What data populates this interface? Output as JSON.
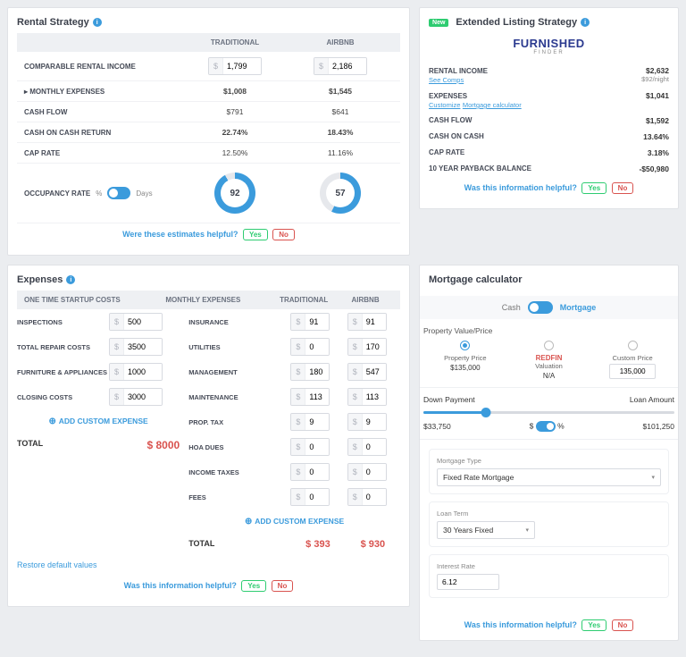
{
  "rental": {
    "title": "Rental Strategy",
    "col_trad": "TRADITIONAL",
    "col_air": "AIRBNB",
    "rows": {
      "income_lbl": "COMPARABLE RENTAL INCOME",
      "income_trad": "1,799",
      "income_air": "2,186",
      "monthly_lbl": "▸ MONTHLY EXPENSES",
      "monthly_trad": "$1,008",
      "monthly_air": "$1,545",
      "cash_lbl": "CASH FLOW",
      "cash_trad": "$791",
      "cash_air": "$641",
      "coc_lbl": "CASH ON CASH RETURN",
      "coc_trad": "22.74%",
      "coc_air": "18.43%",
      "cap_lbl": "CAP RATE",
      "cap_trad": "12.50%",
      "cap_air": "11.16%",
      "occ_lbl": "OCCUPANCY RATE",
      "occ_pct": "%",
      "occ_days": "Days",
      "occ_trad": "92",
      "occ_air": "57"
    },
    "helpful": "Were these estimates helpful?",
    "yes": "Yes",
    "no": "No"
  },
  "ext": {
    "badge": "New",
    "title": "Extended Listing Strategy",
    "logo_main": "FURNISHED",
    "logo_sub": "FINDER",
    "rows": {
      "income_lbl": "RENTAL INCOME",
      "income_val": "$2,632",
      "income_link": "See Comps",
      "income_sub": "$92/night",
      "exp_lbl": "EXPENSES",
      "exp_val": "$1,041",
      "exp_link1": "Customize",
      "exp_link2": "Mortgage calculator",
      "cf_lbl": "CASH FLOW",
      "cf_val": "$1,592",
      "coc_lbl": "CASH ON CASH",
      "coc_val": "13.64%",
      "cap_lbl": "CAP RATE",
      "cap_val": "3.18%",
      "pb_lbl": "10 YEAR PAYBACK BALANCE",
      "pb_val": "-$50,980"
    },
    "helpful": "Was this information helpful?",
    "yes": "Yes",
    "no": "No"
  },
  "expenses": {
    "title": "Expenses",
    "col_one": "ONE TIME STARTUP COSTS",
    "col_monthly": "MONTHLY EXPENSES",
    "col_trad": "TRADITIONAL",
    "col_air": "AIRBNB",
    "one": {
      "insp_lbl": "INSPECTIONS",
      "insp_v": "500",
      "repair_lbl": "TOTAL REPAIR COSTS",
      "repair_v": "3500",
      "furn_lbl": "FURNITURE & APPLIANCES",
      "furn_v": "1000",
      "close_lbl": "CLOSING COSTS",
      "close_v": "3000",
      "total_lbl": "TOTAL",
      "total_v": "$ 8000"
    },
    "monthly": {
      "ins_lbl": "INSURANCE",
      "ins_t": "91",
      "ins_a": "91",
      "util_lbl": "UTILITIES",
      "util_t": "0",
      "util_a": "170",
      "mgmt_lbl": "MANAGEMENT",
      "mgmt_t": "180",
      "mgmt_a": "547",
      "maint_lbl": "MAINTENANCE",
      "maint_t": "113",
      "maint_a": "113",
      "tax_lbl": "PROP. TAX",
      "tax_t": "9",
      "tax_a": "9",
      "hoa_lbl": "HOA DUES",
      "hoa_t": "0",
      "hoa_a": "0",
      "inc_lbl": "INCOME TAXES",
      "inc_t": "0",
      "inc_a": "0",
      "fee_lbl": "FEES",
      "fee_t": "0",
      "fee_a": "0",
      "total_lbl": "TOTAL",
      "total_t": "$ 393",
      "total_a": "$ 930"
    },
    "add": "ADD CUSTOM EXPENSE",
    "restore": "Restore default values",
    "helpful": "Was this information helpful?",
    "yes": "Yes",
    "no": "No"
  },
  "mort": {
    "title": "Mortgage calculator",
    "tab_cash": "Cash",
    "tab_mort": "Mortgage",
    "pv_title": "Property Value/Price",
    "pp_lbl": "Property Price",
    "pp_v": "$135,000",
    "rf_lbl": "Valuation",
    "rf_brand": "REDFIN",
    "rf_v": "N/A",
    "cp_lbl": "Custom Price",
    "cp_v": "135,000",
    "dp_lbl": "Down Payment",
    "la_lbl": "Loan Amount",
    "dp_v": "$33,750",
    "dp_unit": "$",
    "dp_pct": "%",
    "la_v": "$101,250",
    "mt_lbl": "Mortgage Type",
    "mt_v": "Fixed Rate Mortgage",
    "lt_lbl": "Loan Term",
    "lt_v": "30 Years Fixed",
    "ir_lbl": "Interest Rate",
    "ir_v": "6.12",
    "helpful": "Was this information helpful?",
    "yes": "Yes",
    "no": "No"
  },
  "dollar": "$"
}
